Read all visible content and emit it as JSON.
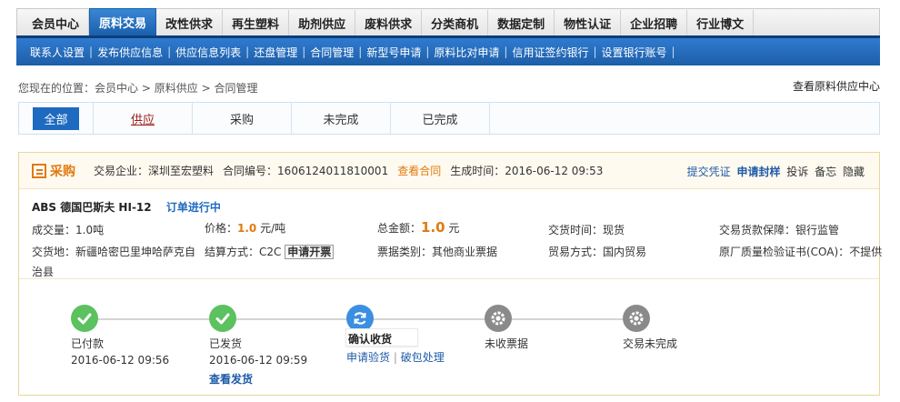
{
  "nav": {
    "tabs": [
      "会员中心",
      "原料交易",
      "改性供求",
      "再生塑料",
      "助剂供应",
      "废料供求",
      "分类商机",
      "数据定制",
      "物性认证",
      "企业招聘",
      "行业博文"
    ],
    "active_index": 1,
    "sub_links": [
      "联系人设置",
      "发布供应信息",
      "供应信息列表",
      "还盘管理",
      "合同管理",
      "新型号申请",
      "原料比对申请",
      "信用证签约银行",
      "设置银行账号"
    ]
  },
  "breadcrumb": {
    "prefix": "您现在的位置：",
    "items": [
      "会员中心",
      "原料供应",
      "合同管理"
    ],
    "sep": ">"
  },
  "view_center": "查看原料供应中心",
  "filter_tabs": [
    "全部",
    "供应",
    "采购",
    "未完成",
    "已完成"
  ],
  "card": {
    "kind": "采购",
    "company_label": "交易企业：",
    "company": "深圳至宏塑料",
    "contract_label": "合同编号：",
    "contract_no": "1606124011810001",
    "view_contract": "查看合同",
    "created_label": "生成时间：",
    "created_at": "2016-06-12 09:53",
    "actions": [
      "提交凭证",
      "申请封样",
      "投诉",
      "备忘",
      "隐藏"
    ],
    "product": "ABS 德国巴斯夫 HI-12",
    "status": "订单进行中",
    "fields": {
      "qty_label": "成交量：",
      "qty": "1.0吨",
      "price_label": "价格：",
      "price": "1.0",
      "price_unit": "元/吨",
      "total_label": "总金额：",
      "total": "1.0",
      "total_unit": "元",
      "delivery_time_label": "交货时间：",
      "delivery_time": "现货",
      "guarantee_label": "交易货款保障：",
      "guarantee": "银行监管",
      "place_label": "交货地：",
      "place_line1": "新疆哈密巴里坤哈萨克自",
      "place_line2": "治县",
      "settle_label": "结算方式：",
      "settle": "C2C",
      "invoice_btn": "申请开票",
      "bill_label": "票据类别：",
      "bill": "其他商业票据",
      "trade_label": "贸易方式：",
      "trade": "国内贸易",
      "coa_label": "原厂质量检验证书(COA)：",
      "coa": "不提供"
    },
    "steps": [
      {
        "label": "已付款",
        "time": "2016-06-12 09:56",
        "state": "done",
        "icon": "check-icon"
      },
      {
        "label": "已发货",
        "time": "2016-06-12 09:59",
        "link": "查看发货",
        "state": "done",
        "icon": "check-icon"
      },
      {
        "label": "确认收货",
        "links": [
          "申请验货",
          "破包处理"
        ],
        "sep": "|",
        "state": "current",
        "icon": "refresh-icon"
      },
      {
        "label": "未收票据",
        "state": "todo",
        "icon": "gear-icon"
      },
      {
        "label": "交易未完成",
        "state": "todo",
        "icon": "gear-icon"
      }
    ],
    "colors": {
      "done": "#5cc15f",
      "current": "#3b8fe0",
      "todo": "#8a8a8a",
      "accent": "#e07a10",
      "brand": "#1e6ac0"
    }
  }
}
